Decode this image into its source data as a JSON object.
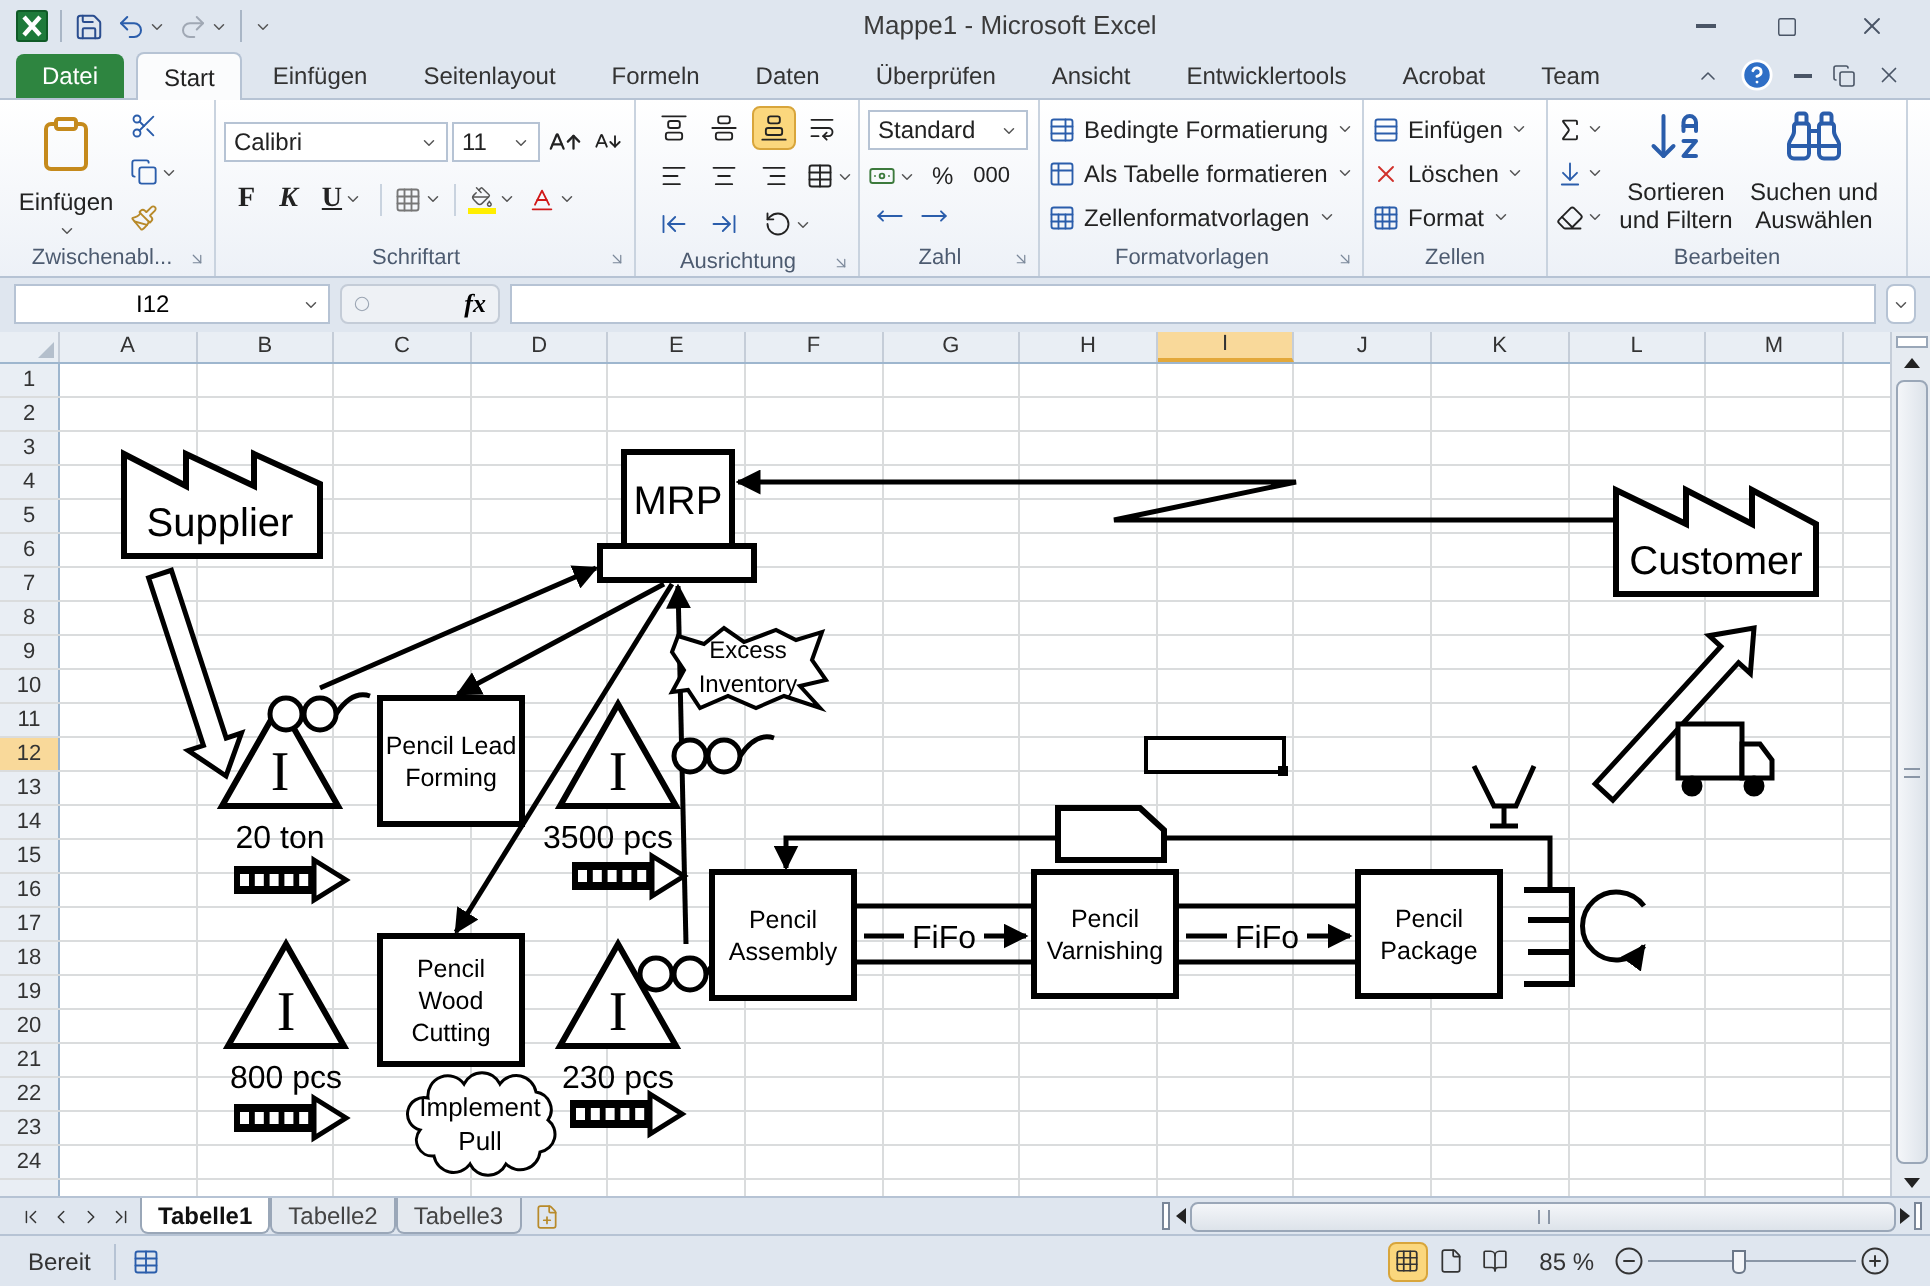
{
  "window": {
    "title": "Mappe1 - Microsoft Excel"
  },
  "ribbon_tabs": [
    {
      "label": "Datei",
      "kind": "file",
      "selected": false
    },
    {
      "label": "Start",
      "kind": "tab",
      "selected": true
    },
    {
      "label": "Einfügen",
      "kind": "tab",
      "selected": false
    },
    {
      "label": "Seitenlayout",
      "kind": "tab",
      "selected": false
    },
    {
      "label": "Formeln",
      "kind": "tab",
      "selected": false
    },
    {
      "label": "Daten",
      "kind": "tab",
      "selected": false
    },
    {
      "label": "Überprüfen",
      "kind": "tab",
      "selected": false
    },
    {
      "label": "Ansicht",
      "kind": "tab",
      "selected": false
    },
    {
      "label": "Entwicklertools",
      "kind": "tab",
      "selected": false
    },
    {
      "label": "Acrobat",
      "kind": "tab",
      "selected": false
    },
    {
      "label": "Team",
      "kind": "tab",
      "selected": false
    }
  ],
  "clipboard": {
    "paste": "Einfügen",
    "label": "Zwischenabl..."
  },
  "font": {
    "name": "Calibri",
    "size": "11",
    "bold": "F",
    "italic": "K",
    "underline": "U",
    "label": "Schriftart"
  },
  "alignment": {
    "vertical": [
      {
        "selected": false
      },
      {
        "selected": false
      },
      {
        "selected": true
      }
    ],
    "label": "Ausrichtung"
  },
  "number": {
    "format": "Standard",
    "percent": "%",
    "thousands": "000",
    "label": "Zahl"
  },
  "styles": {
    "items": [
      "Bedingte Formatierung",
      "Als Tabelle formatieren",
      "Zellenformatvorlagen"
    ],
    "label": "Formatvorlagen"
  },
  "cells": {
    "items": [
      "Einfügen",
      "Löschen",
      "Format"
    ],
    "label": "Zellen"
  },
  "editing": {
    "sort": [
      "Sortieren",
      "und Filtern"
    ],
    "find": [
      "Suchen und",
      "Auswählen"
    ],
    "label": "Bearbeiten"
  },
  "formula_bar": {
    "name_box": "I12",
    "function_button": "fx"
  },
  "sheet": {
    "columns": [
      {
        "label": "A",
        "selected": false
      },
      {
        "label": "B",
        "selected": false
      },
      {
        "label": "C",
        "selected": false
      },
      {
        "label": "D",
        "selected": false
      },
      {
        "label": "E",
        "selected": false
      },
      {
        "label": "F",
        "selected": false
      },
      {
        "label": "G",
        "selected": false
      },
      {
        "label": "H",
        "selected": false
      },
      {
        "label": "I",
        "selected": true
      },
      {
        "label": "J",
        "selected": false
      },
      {
        "label": "K",
        "selected": false
      },
      {
        "label": "L",
        "selected": false
      },
      {
        "label": "M",
        "selected": false
      }
    ],
    "rows": [
      {
        "label": "1",
        "selected": false
      },
      {
        "label": "2",
        "selected": false
      },
      {
        "label": "3",
        "selected": false
      },
      {
        "label": "4",
        "selected": false
      },
      {
        "label": "5",
        "selected": false
      },
      {
        "label": "6",
        "selected": false
      },
      {
        "label": "7",
        "selected": false
      },
      {
        "label": "8",
        "selected": false
      },
      {
        "label": "9",
        "selected": false
      },
      {
        "label": "10",
        "selected": false
      },
      {
        "label": "11",
        "selected": false
      },
      {
        "label": "12",
        "selected": true
      },
      {
        "label": "13",
        "selected": false
      },
      {
        "label": "14",
        "selected": false
      },
      {
        "label": "15",
        "selected": false
      },
      {
        "label": "16",
        "selected": false
      },
      {
        "label": "17",
        "selected": false
      },
      {
        "label": "18",
        "selected": false
      },
      {
        "label": "19",
        "selected": false
      },
      {
        "label": "20",
        "selected": false
      },
      {
        "label": "21",
        "selected": false
      },
      {
        "label": "22",
        "selected": false
      },
      {
        "label": "23",
        "selected": false
      },
      {
        "label": "24",
        "selected": false
      }
    ]
  },
  "diagram": {
    "supplier": "Supplier",
    "customer": "Customer",
    "mrp": "MRP",
    "processes": [
      {
        "lines": [
          "Pencil Lead",
          "Forming"
        ]
      },
      {
        "lines": [
          "Pencil",
          "Wood",
          "Cutting"
        ]
      },
      {
        "lines": [
          "Pencil",
          "Assembly"
        ]
      },
      {
        "lines": [
          "Pencil",
          "Varnishing"
        ]
      },
      {
        "lines": [
          "Pencil",
          "Package"
        ]
      }
    ],
    "inventories": [
      {
        "symbol": "I",
        "amount": "20 ton"
      },
      {
        "symbol": "I",
        "amount": "3500 pcs"
      },
      {
        "symbol": "I",
        "amount": "800 pcs"
      },
      {
        "symbol": "I",
        "amount": "230 pcs"
      }
    ],
    "notes": [
      {
        "kind": "burst",
        "lines": [
          "Excess",
          "Inventory"
        ]
      },
      {
        "kind": "cloud",
        "lines": [
          "Implement",
          "Pull"
        ]
      }
    ],
    "fifo_lanes": [
      "FiFo",
      "FiFo"
    ]
  },
  "sheet_tabs": [
    {
      "label": "Tabelle1",
      "selected": true
    },
    {
      "label": "Tabelle2",
      "selected": false
    },
    {
      "label": "Tabelle3",
      "selected": false
    }
  ],
  "status_bar": {
    "mode": "Bereit",
    "views": [
      {
        "selected": true
      },
      {
        "selected": false
      },
      {
        "selected": false
      }
    ],
    "zoom": "85 %",
    "zoom_slider": {
      "level": 0.43
    }
  }
}
